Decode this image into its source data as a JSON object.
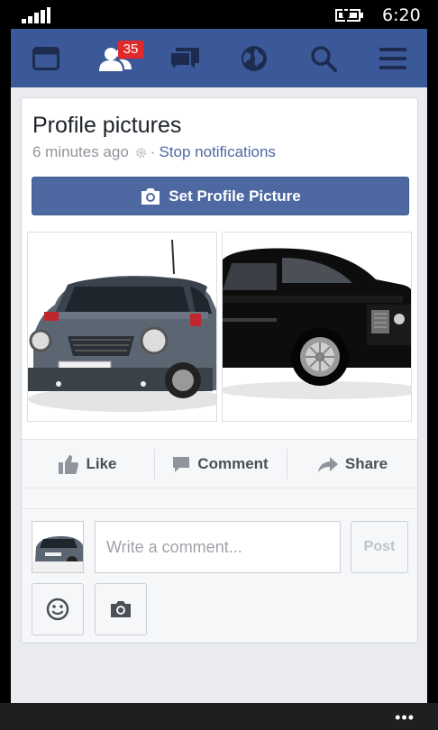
{
  "status_bar": {
    "time": "6:20",
    "signal_icon": "signal-bars-icon",
    "battery_icon": "battery-charging-icon"
  },
  "nav": {
    "items": [
      {
        "name": "news-feed",
        "icon": "news-feed-icon"
      },
      {
        "name": "friend-requests",
        "icon": "friends-icon",
        "badge": "35"
      },
      {
        "name": "messages",
        "icon": "messages-icon"
      },
      {
        "name": "notifications",
        "icon": "globe-icon"
      },
      {
        "name": "search",
        "icon": "search-icon"
      },
      {
        "name": "menu",
        "icon": "menu-icon"
      }
    ],
    "bar_color": "#3b5998",
    "badge_color": "#e02a2a"
  },
  "post": {
    "title": "Profile pictures",
    "time": "6 minutes ago",
    "separator": "·",
    "stop_notifications": "Stop notifications",
    "set_profile_picture": "Set Profile Picture",
    "photos": [
      {
        "name": "silver-mini-cooper",
        "color": "#5b6470"
      },
      {
        "name": "black-rolls-royce",
        "color": "#0c0c0c"
      }
    ]
  },
  "actions": {
    "like": "Like",
    "comment": "Comment",
    "share": "Share"
  },
  "comment_box": {
    "placeholder": "Write a comment...",
    "post": "Post"
  },
  "app_bar": {
    "more": "•••"
  }
}
